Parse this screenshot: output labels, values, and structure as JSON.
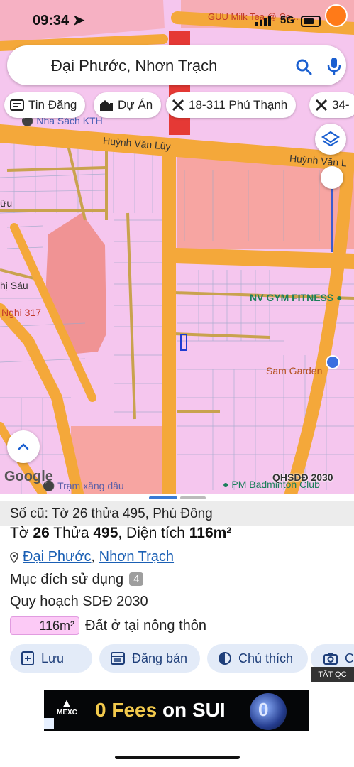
{
  "status_bar": {
    "time": "09:34",
    "network": "5G",
    "top_poi": "GUU Milk Tea @ Co..."
  },
  "search": {
    "query": "Đại Phước, Nhơn Trạch"
  },
  "chips": [
    {
      "label": "Tin Đăng",
      "icon": "news-icon"
    },
    {
      "label": "Dự Án",
      "icon": "project-icon"
    },
    {
      "label": "18-311 Phú Thạnh",
      "icon": "planning-tool-icon"
    },
    {
      "label": "34-",
      "icon": "planning-tool-icon"
    }
  ],
  "map_labels": {
    "bookstore": "Nhà Sách KTH",
    "road_1": "Huỳnh Văn Lũy",
    "road_2": "Huỳnh Văn L",
    "left_1": "ữu",
    "left_2": "hị Sáu",
    "nghi": "Nghi 317",
    "gym": "NV GYM FITNESS",
    "sam_garden": "Sam Garden",
    "gas": "Trạm xăng dầu",
    "badminton": "PM Badminton Club",
    "google": "Google",
    "plan_layer": "QHSDĐ 2030"
  },
  "sheet": {
    "old_ref": "Số cũ: Tờ 26 thửa 495, Phú Đông",
    "title_prefix_1": "Tờ ",
    "sheet_no": "26",
    "title_prefix_2": " Thửa ",
    "parcel_no": "495",
    "title_prefix_3": ", Diện tích ",
    "area": "116m²",
    "location_a": "Đại Phước",
    "location_sep": ", ",
    "location_b": "Nhơn Trạch",
    "purpose_label": "Mục đích sử dụng",
    "purpose_count": "4",
    "plan_label": "Quy hoạch SDĐ 2030",
    "area_chip": "116m²",
    "land_type": "Đất ở tại nông thôn"
  },
  "actions": [
    {
      "label": "Lưu",
      "icon": "add-bookmark-icon"
    },
    {
      "label": "Đăng bán",
      "icon": "calendar-list-icon"
    },
    {
      "label": "Chú thích",
      "icon": "contrast-icon"
    },
    {
      "label": "C",
      "icon": "camera-icon"
    }
  ],
  "ad": {
    "close_label": "TẮT QC",
    "brand": "MEXC",
    "headline_a": "0 Fees",
    "headline_b": " on SUI",
    "badge": "0"
  },
  "colors": {
    "map_pink": "#f5c6ee",
    "road_orange": "#f4a83a",
    "accent_blue": "#1a5fb4",
    "button_bg": "#e3ebf8"
  }
}
